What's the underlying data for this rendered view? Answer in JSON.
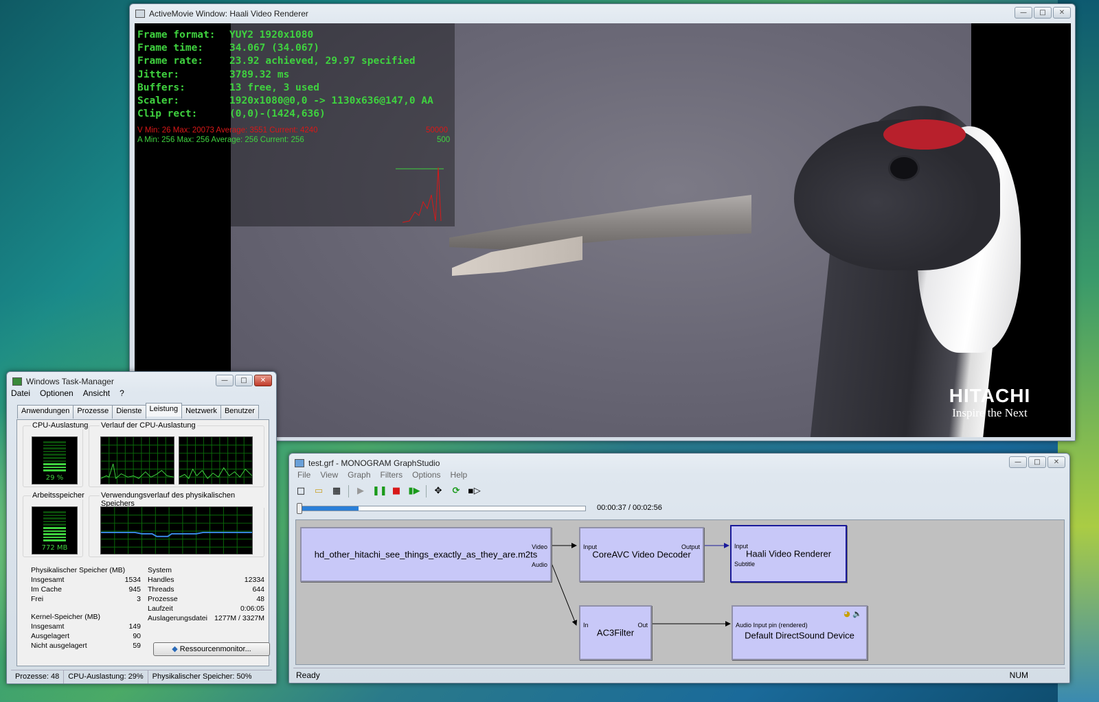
{
  "activemovie": {
    "title": "ActiveMovie Window: Haali Video Renderer",
    "stats": [
      {
        "key": "Frame format:",
        "value": "YUY2 1920x1080"
      },
      {
        "key": "Frame time:",
        "value": "34.067 (34.067)"
      },
      {
        "key": "Frame rate:",
        "value": "23.92 achieved, 29.97 specified"
      },
      {
        "key": "Jitter:",
        "value": "3789.32 ms"
      },
      {
        "key": "Buffers:",
        "value": "13 free, 3 used"
      },
      {
        "key": "Scaler:",
        "value": "1920x1080@0,0 -> 1130x636@147,0 AA"
      },
      {
        "key": "Clip rect:",
        "value": "(0,0)-(1424,636)"
      }
    ],
    "v_line": "V Min: 26  Max: 20073  Average: 3551  Current: 4240",
    "v_max": "50000",
    "a_line": "A Min: 256  Max: 256  Average: 256  Current: 256",
    "a_max": "500",
    "logo": {
      "brand": "HITACHI",
      "tagline": "Inspire the Next"
    }
  },
  "taskmanager": {
    "title": "Windows Task-Manager",
    "menu": [
      "Datei",
      "Optionen",
      "Ansicht",
      "?"
    ],
    "tabs": [
      "Anwendungen",
      "Prozesse",
      "Dienste",
      "Leistung",
      "Netzwerk",
      "Benutzer"
    ],
    "active_tab": "Leistung",
    "cpu_label": "CPU-Auslastung",
    "cpu_value": "29 %",
    "cpu_fraction": 0.29,
    "cpu_history_label": "Verlauf der CPU-Auslastung",
    "mem_label": "Arbeitsspeicher",
    "mem_value": "772 MB",
    "mem_fraction": 0.5,
    "mem_history_label": "Verwendungsverlauf des physikalischen Speichers",
    "physical": {
      "label": "Physikalischer Speicher (MB)",
      "rows": [
        [
          "Insgesamt",
          "1534"
        ],
        [
          "Im Cache",
          "945"
        ],
        [
          "Frei",
          "3"
        ]
      ]
    },
    "kernel": {
      "label": "Kernel-Speicher (MB)",
      "rows": [
        [
          "Insgesamt",
          "149"
        ],
        [
          "Ausgelagert",
          "90"
        ],
        [
          "Nicht ausgelagert",
          "59"
        ]
      ]
    },
    "system": {
      "label": "System",
      "rows": [
        [
          "Handles",
          "12334"
        ],
        [
          "Threads",
          "644"
        ],
        [
          "Prozesse",
          "48"
        ],
        [
          "Laufzeit",
          "0:06:05"
        ],
        [
          "Auslagerungsdatei",
          "1277M / 3327M"
        ]
      ]
    },
    "resource_button": "Ressourcenmonitor...",
    "status": [
      "Prozesse: 48",
      "CPU-Auslastung: 29%",
      "Physikalischer Speicher: 50%"
    ]
  },
  "graphstudio": {
    "title": "test.grf - MONOGRAM GraphStudio",
    "menu": [
      "File",
      "View",
      "Graph",
      "Filters",
      "Options",
      "Help"
    ],
    "time": "00:00:37 / 00:02:56",
    "progress": 0.21,
    "filters": {
      "source": {
        "name": "hd_other_hitachi_see_things_exactly_as_they_are.m2ts",
        "pins": [
          "Video",
          "Audio"
        ]
      },
      "decoder": {
        "name": "CoreAVC Video Decoder",
        "pins": [
          "Input",
          "Output"
        ]
      },
      "renderer": {
        "name": "Haali Video Renderer",
        "pins": [
          "Input",
          "Subtitle"
        ]
      },
      "ac3": {
        "name": "AC3Filter",
        "pins": [
          "In",
          "Out"
        ]
      },
      "dsound": {
        "name": "Default DirectSound Device",
        "pins": [
          "Audio Input pin (rendered)"
        ]
      }
    },
    "status_left": "Ready",
    "status_right": "NUM"
  }
}
